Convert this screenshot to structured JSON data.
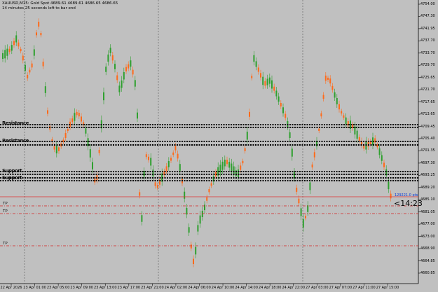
{
  "header": {
    "symbol_line": "XAUUSD,M15: Gold Spot  4689.61 4689.61 4686.65 4686.65",
    "timer_line": "14 minutes 25 seconds left to bar end"
  },
  "price_axis": [
    "4754.00",
    "4747.30",
    "4741.95",
    "4737.70",
    "4733.70",
    "4729.70",
    "4725.65",
    "4721.70",
    "4717.65",
    "4713.65",
    "4709.45",
    "4705.40",
    "4701.35",
    "4697.30",
    "4693.25",
    "4689.20",
    "4685.10",
    "4681.05",
    "4677.00",
    "4673.00",
    "4668.90",
    "4664.85",
    "4660.85"
  ],
  "time_axis": [
    "22 Apr 2026",
    "23 Apr 01:00",
    "23 Apr 05:00",
    "23 Apr 09:00",
    "23 Apr 13:00",
    "23 Apr 17:00",
    "23 Apr 21:00",
    "24 Apr 02:00",
    "24 Apr 06:00",
    "24 Apr 10:00",
    "24 Apr 14:00",
    "24 Apr 18:00",
    "24 Apr 22:00",
    "27 Apr 03:00",
    "27 Apr 07:00",
    "27 Apr 11:00",
    "27 Apr 15:00"
  ],
  "level_labels": [
    "Resistance",
    "Resistance",
    "Support",
    "Support"
  ],
  "tp_labels": [
    "TP",
    "TP",
    "TP"
  ],
  "ask_tag": "129221.0 pts",
  "countdown": "<14:23",
  "colors": {
    "background": "#c0c0c0",
    "bull": "#2ea02e",
    "bear": "#ff6a1a",
    "level_line": "#000000",
    "tp_line": "#d32020",
    "ask_line": "#e03030",
    "separator": "#555555"
  },
  "icons": [
    "chart-grid"
  ]
}
